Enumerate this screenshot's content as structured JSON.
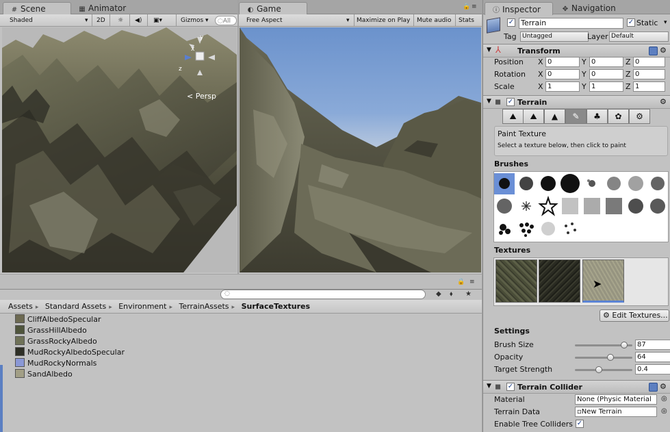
{
  "scene": {
    "tab_label": "Scene",
    "animator_tab": "Animator",
    "shading": "Shaded",
    "mode_2d": "2D",
    "gizmos": "Gizmos",
    "search_placeholder": "All",
    "persp_label": "Persp",
    "axis_x": "x",
    "axis_y": "y",
    "axis_z": "z"
  },
  "game": {
    "tab_label": "Game",
    "aspect": "Free Aspect",
    "maximize": "Maximize on Play",
    "mute": "Mute audio",
    "stats": "Stats"
  },
  "project": {
    "breadcrumb": [
      "Assets",
      "Standard Assets",
      "Environment",
      "TerrainAssets",
      "SurfaceTextures"
    ],
    "files": [
      {
        "name": "CliffAlbedoSpecular",
        "color": "#6d6a52"
      },
      {
        "name": "GrassHillAlbedo",
        "color": "#4f553c"
      },
      {
        "name": "GrassRockyAlbedo",
        "color": "#6f7258"
      },
      {
        "name": "MudRockyAlbedoSpecular",
        "color": "#2e2f26"
      },
      {
        "name": "MudRockyNormals",
        "color": "#8a98d6"
      },
      {
        "name": "SandAlbedo",
        "color": "#a29f86"
      }
    ]
  },
  "inspector": {
    "tab_label": "Inspector",
    "navigation_tab": "Navigation",
    "object_name": "Terrain",
    "static_label": "Static",
    "tag_label": "Tag",
    "tag_value": "Untagged",
    "layer_label": "Layer",
    "layer_value": "Default",
    "transform": {
      "title": "Transform",
      "position_label": "Position",
      "rotation_label": "Rotation",
      "scale_label": "Scale",
      "x": "X",
      "y": "Y",
      "z": "Z",
      "position": [
        "0",
        "0",
        "0"
      ],
      "rotation": [
        "0",
        "0",
        "0"
      ],
      "scale": [
        "1",
        "1",
        "1"
      ]
    },
    "terrain": {
      "title": "Terrain",
      "tool_title": "Paint Texture",
      "tool_hint": "Select a texture below, then click to paint",
      "brushes_label": "Brushes",
      "textures_label": "Textures",
      "edit_textures": "Edit Textures...",
      "settings_label": "Settings",
      "brush_size_label": "Brush Size",
      "brush_size": "87",
      "brush_size_level": 0.9,
      "opacity_label": "Opacity",
      "opacity": "64",
      "opacity_level": 0.64,
      "strength_label": "Target Strength",
      "strength": "0.4",
      "strength_level": 0.4
    },
    "collider": {
      "title": "Terrain Collider",
      "material_label": "Material",
      "material_value": "None (Physic Material",
      "terrain_data_label": "Terrain Data",
      "terrain_data_value": "New Terrain",
      "tree_colliders_label": "Enable Tree Colliders"
    }
  }
}
